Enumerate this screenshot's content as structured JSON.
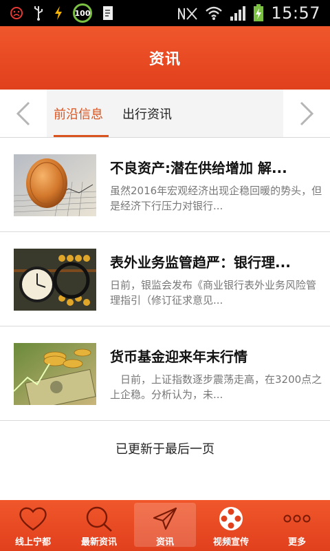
{
  "status_bar": {
    "battery_badge": "100",
    "time": "15:57"
  },
  "header": {
    "title": "资讯"
  },
  "tabs": [
    {
      "label": "前沿信息",
      "active": true
    },
    {
      "label": "出行资讯",
      "active": false
    }
  ],
  "articles": [
    {
      "title": "不良资产:潜在供给增加 解...",
      "desc": "虽然2016年宏观经济出现企稳回暖的势头，但是经济下行压力对银行...",
      "thumb": "coin-chart-icon"
    },
    {
      "title": "表外业务监管趋严：银行理...",
      "desc": "日前，银监会发布《商业银行表外业务风险管理指引（修订征求意见...",
      "thumb": "abacus-clock-icon"
    },
    {
      "title": "货币基金迎来年末行情",
      "desc": "　日前，上证指数逐步震荡走高，在3200点之上企稳。分析认为，未...",
      "thumb": "money-coins-icon"
    }
  ],
  "footer_note": "已更新于最后一页",
  "bottom_nav": [
    {
      "label": "线上宁都",
      "icon": "heart-icon",
      "active": false
    },
    {
      "label": "最新资讯",
      "icon": "search-icon",
      "active": false
    },
    {
      "label": "资讯",
      "icon": "send-icon",
      "active": true
    },
    {
      "label": "视频宣传",
      "icon": "film-reel-icon",
      "active": false
    },
    {
      "label": "更多",
      "icon": "more-dots-icon",
      "active": false
    }
  ],
  "colors": {
    "brand": "#e8481f",
    "tab_active": "#d9531e"
  }
}
